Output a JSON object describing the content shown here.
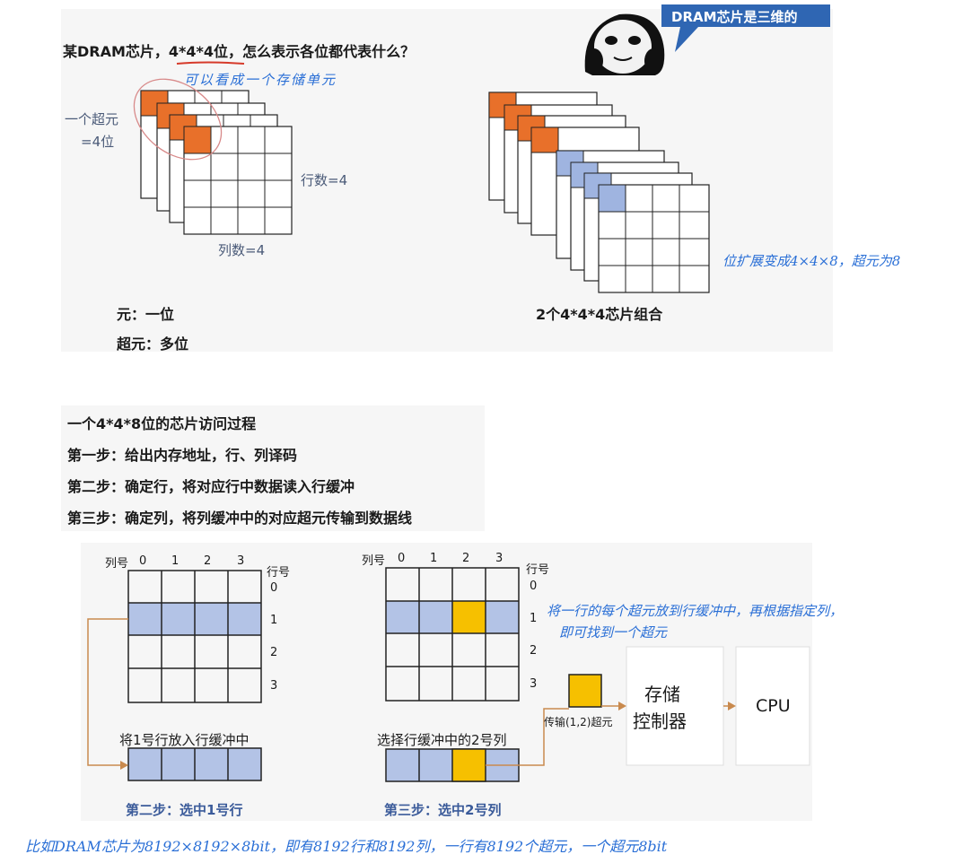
{
  "top": {
    "title_prefix": "某DRAM芯片，",
    "title_highlight": "4*4*4位，",
    "title_suffix": "怎么表示各位都代表什么？",
    "handnote_cell": "可以看成一个存储单元",
    "super_cell_label_1": "一个超元",
    "super_cell_label_2": "=4位",
    "rows_label": "行数=4",
    "cols_label": "列数=4",
    "cell_def": "元：一位",
    "super_def": "超元：多位",
    "combo_label": "2个4*4*4芯片组合",
    "handnote_extend": "位扩展变成4×4×8，超元为8",
    "bubble_text": "DRAM芯片是三维的"
  },
  "steps": {
    "title": "一个4*4*8位的芯片访问过程",
    "step1": "第一步：给出内存地址，行、列译码",
    "step2": "第二步：确定行，将对应行中数据读入行缓冲",
    "step3": "第三步：确定列，将列缓冲中的对应超元传输到数据线"
  },
  "bottom": {
    "col_header": "列号",
    "row_header": "行号",
    "col_nums": [
      "0",
      "1",
      "2",
      "3"
    ],
    "row_nums": [
      "0",
      "1",
      "2",
      "3"
    ],
    "left_buffer_label": "将1号行放入行缓冲中",
    "left_caption": "第二步：选中1号行",
    "right_buffer_label": "选择行缓冲中的2号列",
    "right_caption": "第三步：选中2号列",
    "transfer_label": "传输(1,2)超元",
    "controller_line1": "存储",
    "controller_line2": "控制器",
    "cpu_label": "CPU",
    "handnote_line1": "将一行的每个超元放到行缓冲中，再根据指定列，",
    "handnote_line2": "即可找到一个超元"
  },
  "footer_note": "比如DRAM芯片为8192×8192×8bit，即有8192行和8192列，一行有8192个超元，一个超元8bit",
  "colors": {
    "orange": "#e8702a",
    "blue_cell": "#b3c3e6",
    "yellow": "#f6c000",
    "arrow": "#c98a4e",
    "handwriting": "#2a6fd6"
  }
}
